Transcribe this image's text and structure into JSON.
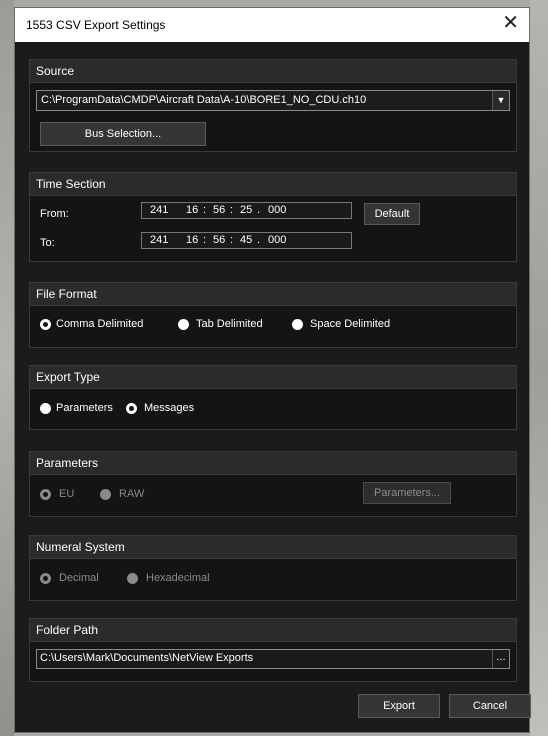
{
  "window": {
    "title": "1553 CSV Export Settings"
  },
  "source": {
    "header": "Source",
    "file_path": "C:\\ProgramData\\CMDP\\Aircraft Data\\A-10\\BORE1_NO_CDU.ch10",
    "bus_selection_label": "Bus Selection..."
  },
  "time_section": {
    "header": "Time Section",
    "from_label": "From:",
    "to_label": "To:",
    "from": {
      "day": "241",
      "hour": "16",
      "min": "56",
      "sec": "25",
      "ms": "000"
    },
    "to": {
      "day": "241",
      "hour": "16",
      "min": "56",
      "sec": "45",
      "ms": "000"
    },
    "default_label": "Default"
  },
  "file_format": {
    "header": "File Format",
    "options": [
      "Comma Delimited",
      "Tab Delimited",
      "Space Delimited"
    ],
    "selected": "Comma Delimited"
  },
  "export_type": {
    "header": "Export Type",
    "options": [
      "Parameters",
      "Messages"
    ],
    "selected": "Messages"
  },
  "parameters": {
    "header": "Parameters",
    "options": [
      "EU",
      "RAW"
    ],
    "selected": "EU",
    "button_label": "Parameters..."
  },
  "numeral_system": {
    "header": "Numeral System",
    "options": [
      "Decimal",
      "Hexadecimal"
    ],
    "selected": "Decimal"
  },
  "folder_path": {
    "header": "Folder Path",
    "path": "C:\\Users\\Mark\\Documents\\NetView Exports",
    "browse_label": "..."
  },
  "footer": {
    "export_label": "Export",
    "cancel_label": "Cancel"
  }
}
